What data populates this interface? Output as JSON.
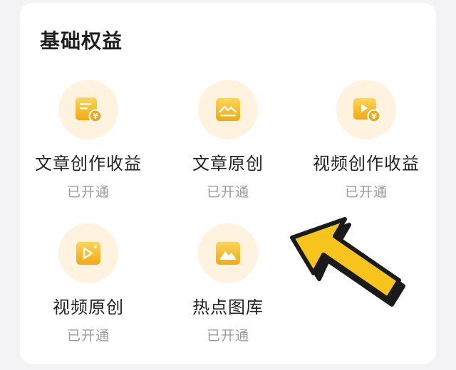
{
  "section": {
    "title": "基础权益"
  },
  "benefits": [
    {
      "label": "文章创作收益",
      "status": "已开通",
      "icon": "article-income-icon"
    },
    {
      "label": "文章原创",
      "status": "已开通",
      "icon": "article-original-icon"
    },
    {
      "label": "视频创作收益",
      "status": "已开通",
      "icon": "video-income-icon"
    },
    {
      "label": "视频原创",
      "status": "已开通",
      "icon": "video-original-icon"
    },
    {
      "label": "热点图库",
      "status": "已开通",
      "icon": "hot-gallery-icon"
    }
  ],
  "colors": {
    "accent": "#f5b820",
    "icon_bg": "#fff3e0",
    "arrow_fill": "#f7c31d",
    "arrow_outline": "#1a1a1a"
  }
}
